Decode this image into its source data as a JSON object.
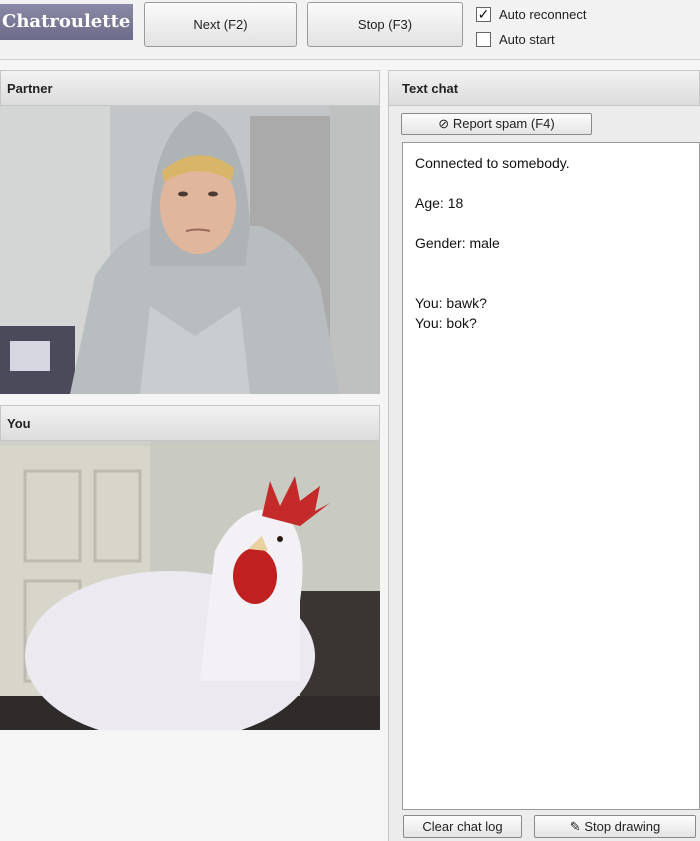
{
  "app": {
    "logo": "Chatroulette"
  },
  "toolbar": {
    "next_label": "Next (F2)",
    "stop_label": "Stop (F3)",
    "auto_reconnect_label": "Auto reconnect",
    "auto_reconnect_checked": true,
    "auto_start_label": "Auto start",
    "auto_start_checked": false
  },
  "panels": {
    "partner_title": "Partner",
    "you_title": "You",
    "chat_title": "Text chat"
  },
  "chat": {
    "report_label": "Report spam (F4)",
    "messages": {
      "m0": "Connected to somebody.",
      "m1": "Age: 18",
      "m2": "Gender: male",
      "m3": "You: bawk?",
      "m4": "You: bok?"
    },
    "clear_label": "Clear chat log",
    "draw_label": "Stop drawing"
  },
  "colors": {
    "logo_bg": "#7a7a98",
    "panel_header_bg": "#e4e4e4",
    "chat_bg": "#ffffff"
  },
  "icons": {
    "report": "no-entry-icon",
    "draw": "pencil-icon",
    "check": "checkmark-icon"
  }
}
